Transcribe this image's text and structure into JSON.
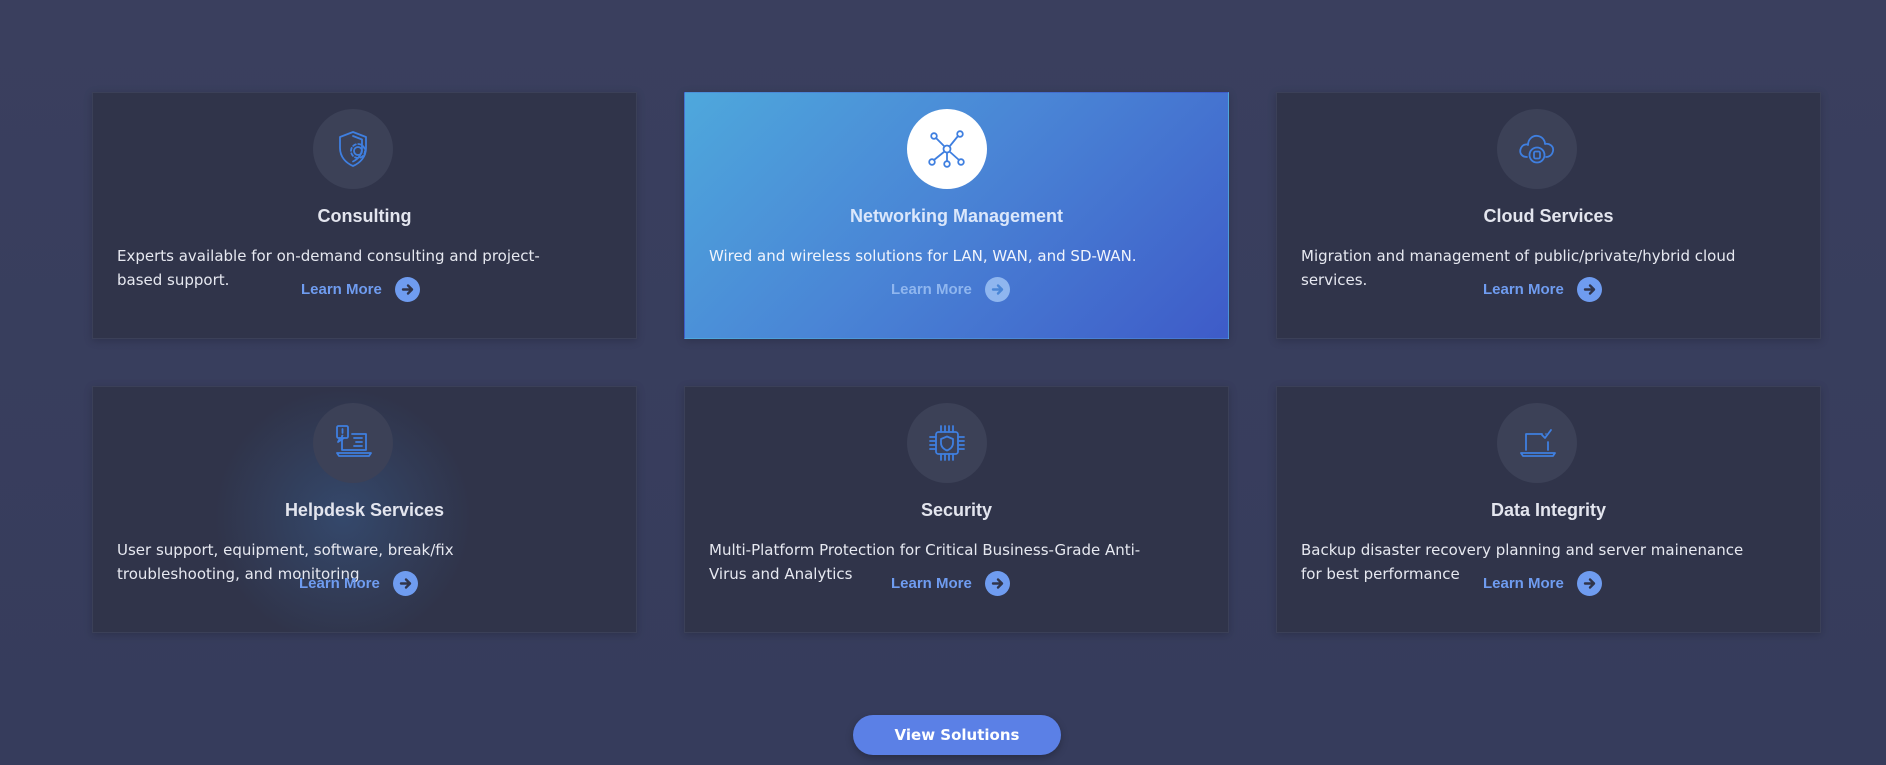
{
  "colors": {
    "background": "#383d5d",
    "card": "#30344a",
    "accent": "#6f9cf0",
    "active_gradient_start": "#4ea8dc",
    "active_gradient_end": "#3e5bc8",
    "button": "#5b80e6"
  },
  "services": [
    {
      "title": "Consulting",
      "description": "Experts available for on-demand consulting and project-based support.",
      "learn_more": "Learn More",
      "icon": "shield-gear-icon"
    },
    {
      "title": "Networking Management",
      "description": "Wired and wireless solutions for LAN, WAN, and SD-WAN.",
      "learn_more": "Learn More",
      "icon": "network-icon",
      "active": true
    },
    {
      "title": "Cloud Services",
      "description": "Migration and management of public/private/hybrid cloud services.",
      "learn_more": "Learn More",
      "icon": "cloud-icon"
    },
    {
      "title": "Helpdesk Services",
      "description": "User support, equipment, software, break/fix troubleshooting, and monitoring",
      "learn_more": "Learn More",
      "icon": "laptop-alert-icon"
    },
    {
      "title": "Security",
      "description": "Multi-Platform Protection for Critical Business-Grade Anti-Virus and Analytics",
      "learn_more": "Learn More",
      "icon": "chip-shield-icon"
    },
    {
      "title": "Data Integrity",
      "description": "Backup disaster recovery planning and server mainenance for best performance",
      "learn_more": "Learn More",
      "icon": "laptop-check-icon"
    }
  ],
  "cta": {
    "label": "View Solutions"
  }
}
